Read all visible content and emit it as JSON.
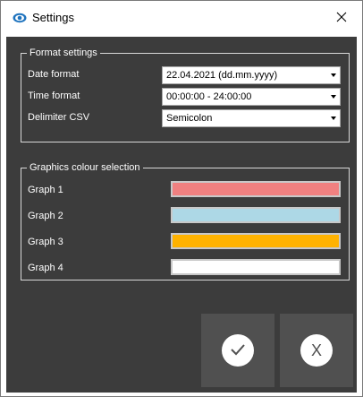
{
  "window": {
    "title": "Settings",
    "title_icon": "eye-settings-icon",
    "close_icon": "close-icon"
  },
  "format_settings": {
    "legend": "Format settings",
    "date_format": {
      "label": "Date format",
      "value": "22.04.2021 (dd.mm.yyyy)"
    },
    "time_format": {
      "label": "Time format",
      "value": "00:00:00 - 24:00:00"
    },
    "delimiter_csv": {
      "label": "Delimiter CSV",
      "value": "Semicolon"
    }
  },
  "graphics_colour_selection": {
    "legend": "Graphics colour selection",
    "graphs": [
      {
        "label": "Graph 1",
        "color": "#f08080"
      },
      {
        "label": "Graph 2",
        "color": "#add8e6"
      },
      {
        "label": "Graph 3",
        "color": "#ffb200"
      },
      {
        "label": "Graph 4",
        "color": "#ffffff"
      }
    ]
  },
  "actions": {
    "ok_icon": "checkmark-icon",
    "cancel_icon": "x-icon",
    "cancel_glyph": "X"
  },
  "colors": {
    "client_background": "#3c3c3c",
    "button_background": "#505050",
    "title_icon_color": "#1e73be"
  }
}
